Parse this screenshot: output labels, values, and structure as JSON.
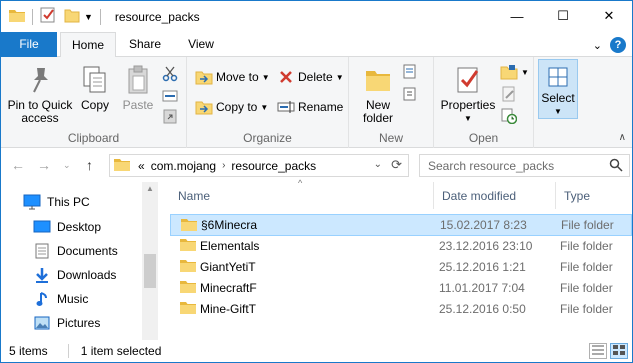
{
  "window": {
    "title": "resource_packs",
    "controls": {
      "minimize": "—",
      "maximize": "☐",
      "close": "✕"
    }
  },
  "tabs": [
    {
      "label": "File"
    },
    {
      "label": "Home"
    },
    {
      "label": "Share"
    },
    {
      "label": "View"
    }
  ],
  "ribbon": {
    "clipboard": {
      "label": "Clipboard",
      "pin_to_quick_access": "Pin to Quick access",
      "copy": "Copy",
      "paste": "Paste"
    },
    "organize": {
      "label": "Organize",
      "move_to": "Move to",
      "copy_to": "Copy to",
      "delete": "Delete",
      "rename": "Rename"
    },
    "new": {
      "label": "New",
      "new_folder": "New folder"
    },
    "open": {
      "label": "Open",
      "properties": "Properties"
    },
    "select": {
      "label": "Select"
    }
  },
  "address": {
    "overflow": "«",
    "crumbs": [
      "com.mojang",
      "resource_packs"
    ],
    "search_placeholder": "Search resource_packs"
  },
  "nav_pane": {
    "items": [
      {
        "label": "This PC",
        "icon": "computer-icon"
      },
      {
        "label": "Desktop",
        "icon": "desktop-icon"
      },
      {
        "label": "Documents",
        "icon": "documents-icon"
      },
      {
        "label": "Downloads",
        "icon": "downloads-icon"
      },
      {
        "label": "Music",
        "icon": "music-icon"
      },
      {
        "label": "Pictures",
        "icon": "pictures-icon"
      }
    ]
  },
  "file_list": {
    "columns": {
      "name": "Name",
      "date": "Date modified",
      "type": "Type"
    },
    "rows": [
      {
        "name": "§6Minecra",
        "date": "15.02.2017 8:23",
        "type": "File folder",
        "selected": true
      },
      {
        "name": "Elementals",
        "date": "23.12.2016 23:10",
        "type": "File folder",
        "selected": false
      },
      {
        "name": "GiantYetiT",
        "date": "25.12.2016 1:21",
        "type": "File folder",
        "selected": false
      },
      {
        "name": "MinecraftF",
        "date": "11.01.2017 7:04",
        "type": "File folder",
        "selected": false
      },
      {
        "name": "Mine-GiftT",
        "date": "25.12.2016 0:50",
        "type": "File folder",
        "selected": false
      }
    ]
  },
  "status_bar": {
    "item_count": "5 items",
    "selection": "1 item selected"
  },
  "colors": {
    "accent": "#1979ca",
    "folder": "#f8d775",
    "selected_row": "#cce8ff"
  }
}
